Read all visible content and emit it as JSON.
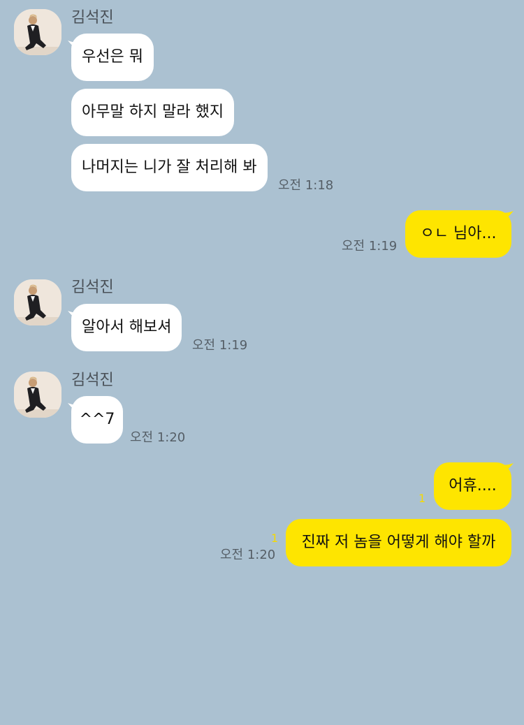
{
  "theme": {
    "background": "#abc1d1",
    "incoming_bubble": "#ffffff",
    "outgoing_bubble": "#fee500",
    "read_count_color": "#f5d900"
  },
  "messages": [
    {
      "sender": "김석진",
      "avatar_icon": "profile-photo",
      "bubbles": [
        "우선은 뭐",
        "아무말 하지 말라 했지",
        "나머지는 니가 잘 처리해 봐"
      ],
      "time": "오전 1:18"
    },
    {
      "direction": "outgoing",
      "bubbles": [
        "ㅇㄴ 님아..."
      ],
      "time": "오전 1:19"
    },
    {
      "sender": "김석진",
      "avatar_icon": "profile-photo",
      "bubbles": [
        "알아서 해보셔"
      ],
      "time": "오전 1:19"
    },
    {
      "sender": "김석진",
      "avatar_icon": "profile-photo",
      "bubbles": [
        "^^7"
      ],
      "time": "오전 1:20"
    },
    {
      "direction": "outgoing",
      "bubbles": [
        {
          "text": "어휴....",
          "unread": "1"
        },
        {
          "text": "진짜 저 놈을 어떻게 해야 할까",
          "unread": "1"
        }
      ],
      "time": "오전 1:20"
    }
  ]
}
